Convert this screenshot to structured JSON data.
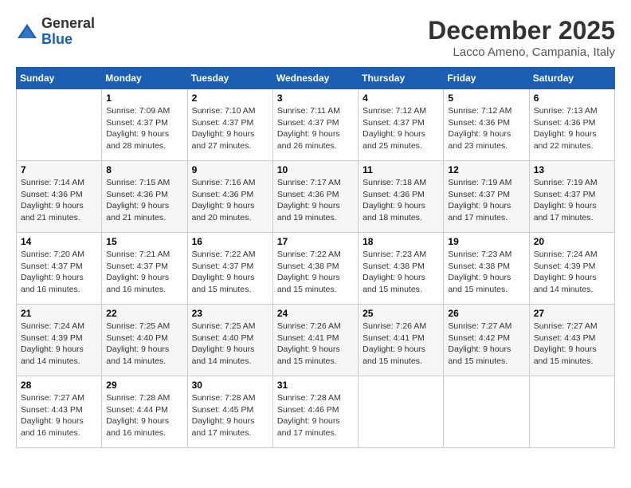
{
  "header": {
    "logo_general": "General",
    "logo_blue": "Blue",
    "month_title": "December 2025",
    "location": "Lacco Ameno, Campania, Italy"
  },
  "weekdays": [
    "Sunday",
    "Monday",
    "Tuesday",
    "Wednesday",
    "Thursday",
    "Friday",
    "Saturday"
  ],
  "weeks": [
    [
      {
        "day": "",
        "info": ""
      },
      {
        "day": "1",
        "info": "Sunrise: 7:09 AM\nSunset: 4:37 PM\nDaylight: 9 hours\nand 28 minutes."
      },
      {
        "day": "2",
        "info": "Sunrise: 7:10 AM\nSunset: 4:37 PM\nDaylight: 9 hours\nand 27 minutes."
      },
      {
        "day": "3",
        "info": "Sunrise: 7:11 AM\nSunset: 4:37 PM\nDaylight: 9 hours\nand 26 minutes."
      },
      {
        "day": "4",
        "info": "Sunrise: 7:12 AM\nSunset: 4:37 PM\nDaylight: 9 hours\nand 25 minutes."
      },
      {
        "day": "5",
        "info": "Sunrise: 7:12 AM\nSunset: 4:36 PM\nDaylight: 9 hours\nand 23 minutes."
      },
      {
        "day": "6",
        "info": "Sunrise: 7:13 AM\nSunset: 4:36 PM\nDaylight: 9 hours\nand 22 minutes."
      }
    ],
    [
      {
        "day": "7",
        "info": "Sunrise: 7:14 AM\nSunset: 4:36 PM\nDaylight: 9 hours\nand 21 minutes."
      },
      {
        "day": "8",
        "info": "Sunrise: 7:15 AM\nSunset: 4:36 PM\nDaylight: 9 hours\nand 21 minutes."
      },
      {
        "day": "9",
        "info": "Sunrise: 7:16 AM\nSunset: 4:36 PM\nDaylight: 9 hours\nand 20 minutes."
      },
      {
        "day": "10",
        "info": "Sunrise: 7:17 AM\nSunset: 4:36 PM\nDaylight: 9 hours\nand 19 minutes."
      },
      {
        "day": "11",
        "info": "Sunrise: 7:18 AM\nSunset: 4:36 PM\nDaylight: 9 hours\nand 18 minutes."
      },
      {
        "day": "12",
        "info": "Sunrise: 7:19 AM\nSunset: 4:37 PM\nDaylight: 9 hours\nand 17 minutes."
      },
      {
        "day": "13",
        "info": "Sunrise: 7:19 AM\nSunset: 4:37 PM\nDaylight: 9 hours\nand 17 minutes."
      }
    ],
    [
      {
        "day": "14",
        "info": "Sunrise: 7:20 AM\nSunset: 4:37 PM\nDaylight: 9 hours\nand 16 minutes."
      },
      {
        "day": "15",
        "info": "Sunrise: 7:21 AM\nSunset: 4:37 PM\nDaylight: 9 hours\nand 16 minutes."
      },
      {
        "day": "16",
        "info": "Sunrise: 7:22 AM\nSunset: 4:37 PM\nDaylight: 9 hours\nand 15 minutes."
      },
      {
        "day": "17",
        "info": "Sunrise: 7:22 AM\nSunset: 4:38 PM\nDaylight: 9 hours\nand 15 minutes."
      },
      {
        "day": "18",
        "info": "Sunrise: 7:23 AM\nSunset: 4:38 PM\nDaylight: 9 hours\nand 15 minutes."
      },
      {
        "day": "19",
        "info": "Sunrise: 7:23 AM\nSunset: 4:38 PM\nDaylight: 9 hours\nand 15 minutes."
      },
      {
        "day": "20",
        "info": "Sunrise: 7:24 AM\nSunset: 4:39 PM\nDaylight: 9 hours\nand 14 minutes."
      }
    ],
    [
      {
        "day": "21",
        "info": "Sunrise: 7:24 AM\nSunset: 4:39 PM\nDaylight: 9 hours\nand 14 minutes."
      },
      {
        "day": "22",
        "info": "Sunrise: 7:25 AM\nSunset: 4:40 PM\nDaylight: 9 hours\nand 14 minutes."
      },
      {
        "day": "23",
        "info": "Sunrise: 7:25 AM\nSunset: 4:40 PM\nDaylight: 9 hours\nand 14 minutes."
      },
      {
        "day": "24",
        "info": "Sunrise: 7:26 AM\nSunset: 4:41 PM\nDaylight: 9 hours\nand 15 minutes."
      },
      {
        "day": "25",
        "info": "Sunrise: 7:26 AM\nSunset: 4:41 PM\nDaylight: 9 hours\nand 15 minutes."
      },
      {
        "day": "26",
        "info": "Sunrise: 7:27 AM\nSunset: 4:42 PM\nDaylight: 9 hours\nand 15 minutes."
      },
      {
        "day": "27",
        "info": "Sunrise: 7:27 AM\nSunset: 4:43 PM\nDaylight: 9 hours\nand 15 minutes."
      }
    ],
    [
      {
        "day": "28",
        "info": "Sunrise: 7:27 AM\nSunset: 4:43 PM\nDaylight: 9 hours\nand 16 minutes."
      },
      {
        "day": "29",
        "info": "Sunrise: 7:28 AM\nSunset: 4:44 PM\nDaylight: 9 hours\nand 16 minutes."
      },
      {
        "day": "30",
        "info": "Sunrise: 7:28 AM\nSunset: 4:45 PM\nDaylight: 9 hours\nand 17 minutes."
      },
      {
        "day": "31",
        "info": "Sunrise: 7:28 AM\nSunset: 4:46 PM\nDaylight: 9 hours\nand 17 minutes."
      },
      {
        "day": "",
        "info": ""
      },
      {
        "day": "",
        "info": ""
      },
      {
        "day": "",
        "info": ""
      }
    ]
  ]
}
